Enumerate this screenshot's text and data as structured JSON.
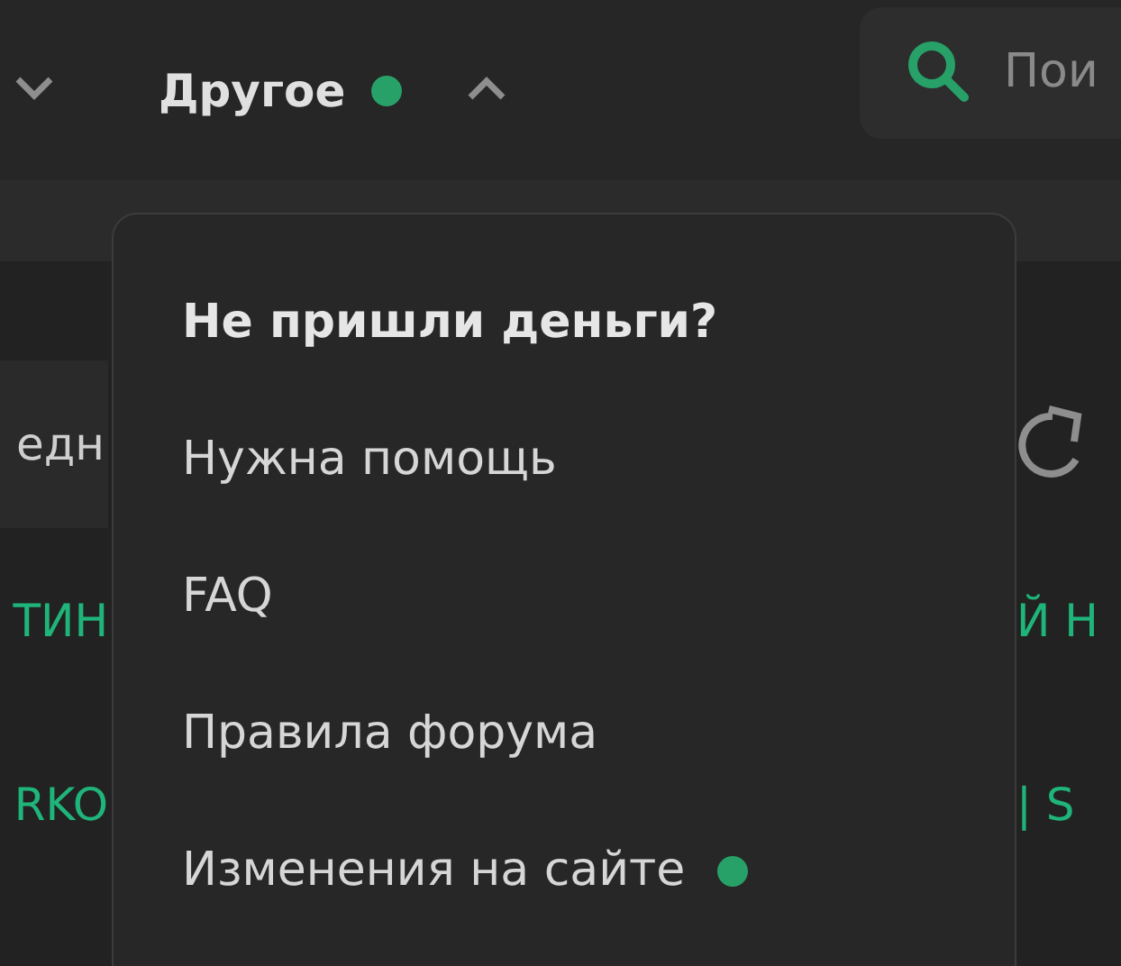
{
  "header": {
    "menu": {
      "label": "Другое",
      "has_new": true,
      "expanded": true
    },
    "search": {
      "placeholder": "Пои"
    }
  },
  "background": {
    "left": [
      {
        "kind": "plain",
        "text": "едн"
      },
      {
        "kind": "link",
        "text": "ТИН"
      },
      {
        "kind": "link",
        "text": "RKO"
      }
    ],
    "right": [
      {
        "kind": "refresh"
      },
      {
        "kind": "link",
        "text": "Й Н"
      },
      {
        "kind": "link",
        "text": "| S"
      }
    ]
  },
  "dropdown": {
    "items": [
      {
        "label": "Не пришли деньги?",
        "bold": true,
        "has_new": false
      },
      {
        "label": "Нужна помощь",
        "bold": false,
        "has_new": false
      },
      {
        "label": "FAQ",
        "bold": false,
        "has_new": false
      },
      {
        "label": "Правила форума",
        "bold": false,
        "has_new": false
      },
      {
        "label": "Изменения на сайте",
        "bold": false,
        "has_new": true
      }
    ]
  }
}
